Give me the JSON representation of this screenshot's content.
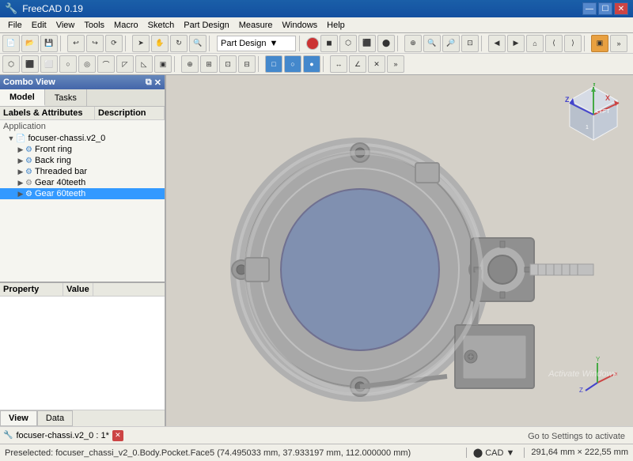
{
  "titleBar": {
    "icon": "🔧",
    "title": "FreeCAD 0.19",
    "controls": [
      "—",
      "☐",
      "✕"
    ]
  },
  "menuBar": {
    "items": [
      "File",
      "Edit",
      "View",
      "Tools",
      "Macro",
      "Sketch",
      "Part Design",
      "Measure",
      "Windows",
      "Help"
    ]
  },
  "toolbar": {
    "workbench": "Part Design",
    "workbench_label": "Part Design"
  },
  "comboView": {
    "title": "Combo View",
    "tabs": [
      "Model",
      "Tasks"
    ],
    "activeTab": "Model",
    "treeColumns": [
      "Labels & Attributes",
      "Description"
    ],
    "application_label": "Application",
    "tree": [
      {
        "id": "root",
        "label": "focuser-chassi.v2_0",
        "indent": 0,
        "expanded": true,
        "icon": "📄",
        "arrow": "▼",
        "selected": false
      },
      {
        "id": "front",
        "label": "Front ring",
        "indent": 1,
        "expanded": false,
        "icon": "⚙",
        "arrow": "▶",
        "selected": false
      },
      {
        "id": "back",
        "label": "Back ring",
        "indent": 1,
        "expanded": false,
        "icon": "⚙",
        "arrow": "▶",
        "selected": false
      },
      {
        "id": "threaded",
        "label": "Threaded bar",
        "indent": 1,
        "expanded": false,
        "icon": "⚙",
        "arrow": "▶",
        "selected": false
      },
      {
        "id": "gear40",
        "label": "Gear 40teeth",
        "indent": 1,
        "expanded": false,
        "icon": "⚙",
        "arrow": "▶",
        "selected": false
      },
      {
        "id": "gear60",
        "label": "Gear 60teeth",
        "indent": 1,
        "expanded": false,
        "icon": "⚙",
        "arrow": "▶",
        "selected": true
      }
    ]
  },
  "propertyPanel": {
    "columns": [
      "Property",
      "Value"
    ]
  },
  "bottomTabs": {
    "items": [
      "View",
      "Data"
    ]
  },
  "fileTab": {
    "icon": "🔧",
    "name": "focuser-chassi.v2_0 : 1*"
  },
  "statusBar": {
    "message": "Preselected: focuser_chassi_v2_0.Body.Pocket.Face5 (74.495033 mm, 37.933197 mm, 112.000000 mm)",
    "cad": "⬤ CAD ▼",
    "dimensions": "291,64 mm × 222,55 mm",
    "watermark": "Activate Windows"
  }
}
